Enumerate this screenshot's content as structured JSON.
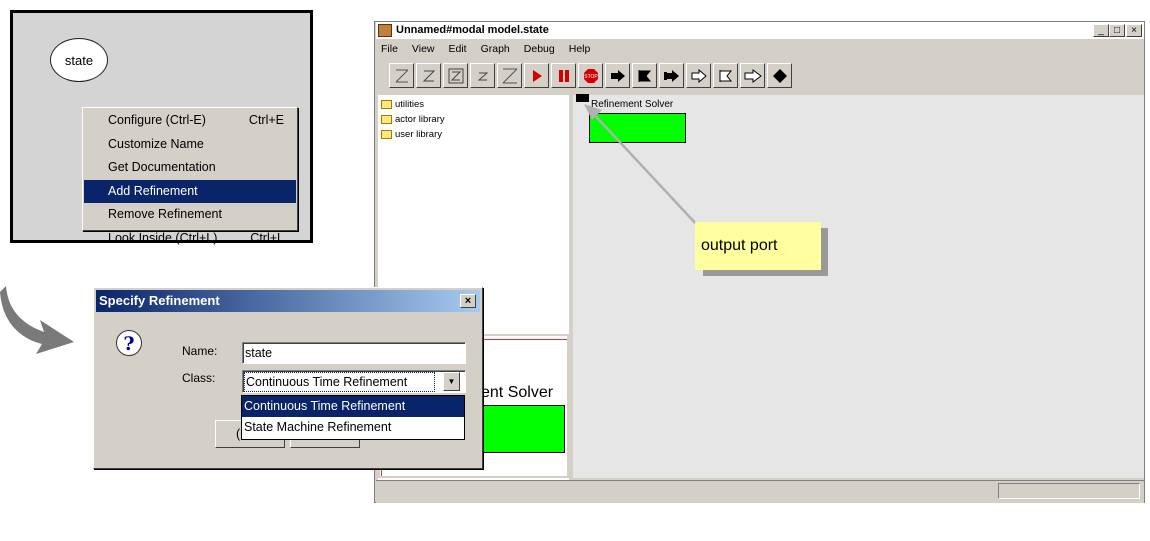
{
  "context_menu": {
    "node_label": "state",
    "items": [
      {
        "label": "Configure (Ctrl-E)",
        "accel": "Ctrl+E",
        "selected": false
      },
      {
        "label": "Customize Name",
        "accel": "",
        "selected": false
      },
      {
        "label": "Get Documentation",
        "accel": "",
        "selected": false
      },
      {
        "label": "Add Refinement",
        "accel": "",
        "selected": true
      },
      {
        "label": "Remove Refinement",
        "accel": "",
        "selected": false
      },
      {
        "label": "Look Inside (Ctrl+L)",
        "accel": "Ctrl+L",
        "selected": false
      }
    ]
  },
  "dialog": {
    "title": "Specify Refinement",
    "close_glyph": "×",
    "icon_glyph": "?",
    "name_label": "Name:",
    "name_value": "state",
    "class_label": "Class:",
    "class_value": "Continuous Time Refinement",
    "class_options": [
      "Continuous Time Refinement",
      "State Machine Refinement"
    ],
    "button_stub_text": "("
  },
  "window": {
    "title": "Unnamed#modal model.state",
    "controls": [
      "_",
      "□",
      "×"
    ],
    "menu": [
      "File",
      "View",
      "Edit",
      "Graph",
      "Debug",
      "Help"
    ],
    "tree": [
      "utilities",
      "actor library",
      "user library"
    ],
    "canvas_actor": "Refinement Solver",
    "lower_panel_text": "ent Solver",
    "callout": "output port"
  },
  "colors": {
    "selection": "#0a246a",
    "actor_fill": "#00ff00",
    "run_red": "#d40000",
    "callout_fill": "#ffffa0",
    "arrow_gray": "#7a7a7a"
  },
  "toolbar_icons": [
    "zoom-reset-icon",
    "zoom-in-icon",
    "zoom-fit-icon",
    "zoom-out-icon",
    "line-icon",
    "run-icon",
    "pause-icon",
    "stop-icon",
    "port-in-icon",
    "port-out-icon",
    "port-inout-icon",
    "multiport-in-icon",
    "multiport-out-icon",
    "multiport-inout-icon",
    "relation-icon"
  ]
}
